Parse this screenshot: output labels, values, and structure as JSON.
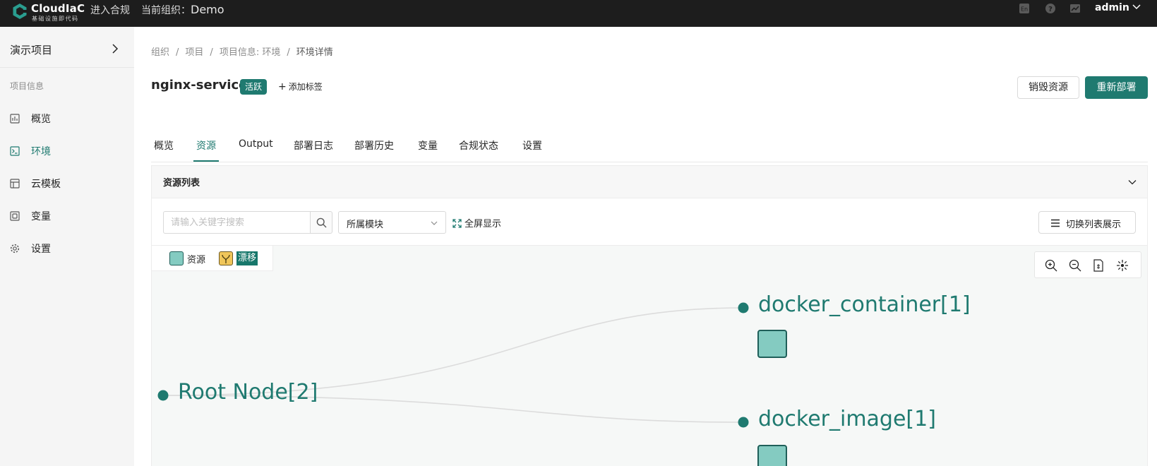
{
  "app": {
    "logo_name": "CloudIaC",
    "logo_sub": "基础设施即代码",
    "top_link": "进入合规",
    "org_label": "当前组织：",
    "org_value": "Demo",
    "lang_icon": "En",
    "user": "admin"
  },
  "sidebar": {
    "project": "演示项目",
    "section": "项目信息",
    "items": [
      {
        "label": "概览",
        "icon": "dashboard-icon"
      },
      {
        "label": "环境",
        "icon": "terminal-icon",
        "active": true
      },
      {
        "label": "云模板",
        "icon": "template-icon"
      },
      {
        "label": "变量",
        "icon": "variable-icon"
      },
      {
        "label": "设置",
        "icon": "gear-icon"
      }
    ]
  },
  "breadcrumb": [
    "组织",
    "项目",
    "项目信息: 环境",
    "环境详情"
  ],
  "env": {
    "name": "nginx-service",
    "status": "活跃",
    "add_tag": "添加标签",
    "destroy_label": "销毁资源",
    "redeploy_label": "重新部署"
  },
  "tabs": [
    "概览",
    "资源",
    "Output",
    "部署日志",
    "部署历史",
    "变量",
    "合规状态",
    "设置"
  ],
  "active_tab": "资源",
  "resources": {
    "panel_title": "资源列表",
    "search_placeholder": "请输入关键字搜索",
    "module_select": "所属模块",
    "fullscreen_label": "全屏显示",
    "switch_label": "切换列表展示",
    "legend": {
      "resource": "资源",
      "drift": "漂移"
    },
    "graph": {
      "root": "Root Node[2]",
      "children": [
        "docker_container[1]",
        "docker_image[1]"
      ]
    }
  },
  "colors": {
    "brand": "#1f7a70",
    "node_fill": "#84cbc1",
    "drift_fill": "#f0c65a",
    "topbar": "#1d1d1d"
  }
}
